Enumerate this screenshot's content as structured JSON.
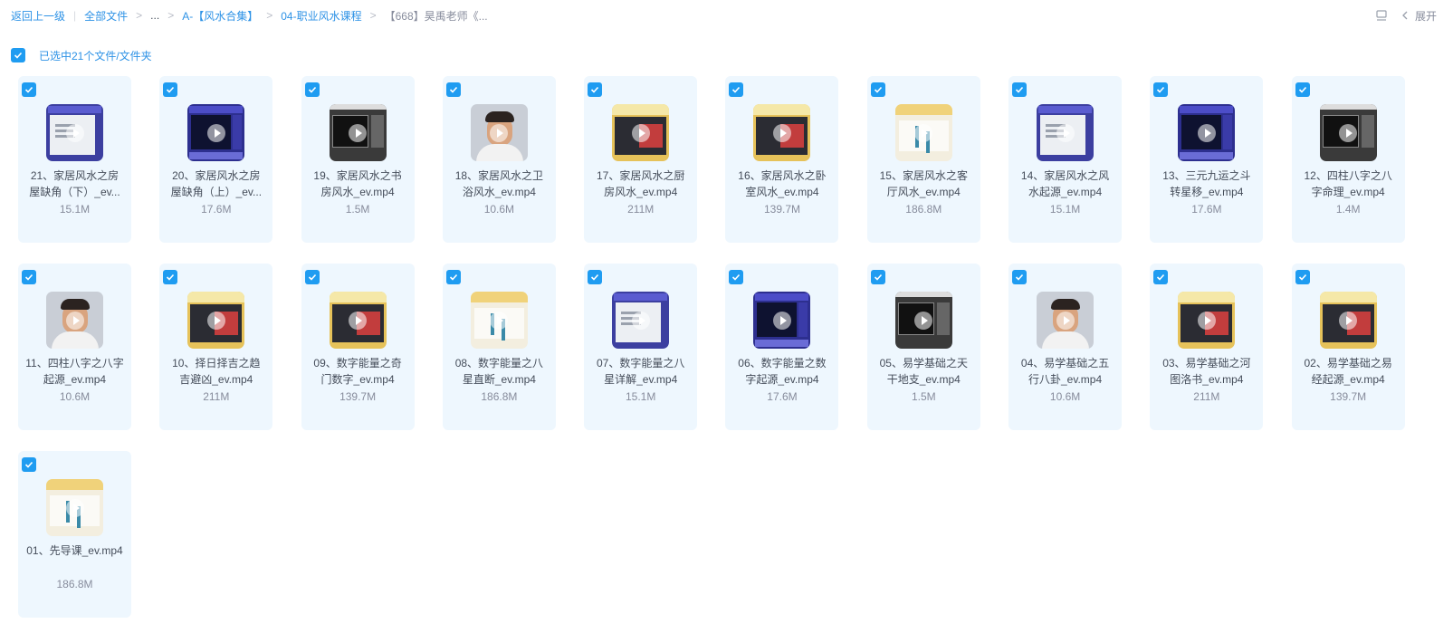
{
  "breadcrumb": {
    "back": "返回上一级",
    "items": [
      "全部文件",
      "...",
      "A-【风水合集】",
      "04-职业风水课程"
    ],
    "current": "【668】昊禹老师《..."
  },
  "toolbar": {
    "expand_label": "展开"
  },
  "selection": {
    "label": "已选中21个文件/文件夹",
    "checked": true
  },
  "files": [
    {
      "name": "21、家居风水之房屋缺角（下）_ev...",
      "size": "15.1M",
      "thumb": "doc"
    },
    {
      "name": "20、家居风水之房屋缺角（上）_ev...",
      "size": "17.6M",
      "thumb": "blue"
    },
    {
      "name": "19、家居风水之书房风水_ev.mp4",
      "size": "1.5M",
      "thumb": "dark"
    },
    {
      "name": "18、家居风水之卫浴风水_ev.mp4",
      "size": "10.6M",
      "thumb": "face"
    },
    {
      "name": "17、家居风水之厨房风水_ev.mp4",
      "size": "211M",
      "thumb": "gold"
    },
    {
      "name": "16、家居风水之卧室风水_ev.mp4",
      "size": "139.7M",
      "thumb": "gold"
    },
    {
      "name": "15、家居风水之客厅风水_ev.mp4",
      "size": "186.8M",
      "thumb": "white"
    },
    {
      "name": "14、家居风水之风水起源_ev.mp4",
      "size": "15.1M",
      "thumb": "doc"
    },
    {
      "name": "13、三元九运之斗转星移_ev.mp4",
      "size": "17.6M",
      "thumb": "blue"
    },
    {
      "name": "12、四柱八字之八字命理_ev.mp4",
      "size": "1.4M",
      "thumb": "dark"
    },
    {
      "name": "11、四柱八字之八字起源_ev.mp4",
      "size": "10.6M",
      "thumb": "face"
    },
    {
      "name": "10、择日择吉之趋吉避凶_ev.mp4",
      "size": "211M",
      "thumb": "gold"
    },
    {
      "name": "09、数字能量之奇门数字_ev.mp4",
      "size": "139.7M",
      "thumb": "gold"
    },
    {
      "name": "08、数字能量之八星直断_ev.mp4",
      "size": "186.8M",
      "thumb": "white"
    },
    {
      "name": "07、数字能量之八星详解_ev.mp4",
      "size": "15.1M",
      "thumb": "doc"
    },
    {
      "name": "06、数字能量之数字起源_ev.mp4",
      "size": "17.6M",
      "thumb": "blue"
    },
    {
      "name": "05、易学基础之天干地支_ev.mp4",
      "size": "1.5M",
      "thumb": "dark"
    },
    {
      "name": "04、易学基础之五行八卦_ev.mp4",
      "size": "10.6M",
      "thumb": "face"
    },
    {
      "name": "03、易学基础之河图洛书_ev.mp4",
      "size": "211M",
      "thumb": "gold"
    },
    {
      "name": "02、易学基础之易经起源_ev.mp4",
      "size": "139.7M",
      "thumb": "gold"
    },
    {
      "name": "01、先导课_ev.mp4",
      "size": "186.8M",
      "thumb": "white"
    }
  ],
  "colors": {
    "accent": "#2d92e6",
    "checkbox": "#1f9cf1",
    "card_bg": "#eef7fe",
    "text": "#454d5a",
    "muted": "#878c9c"
  },
  "icons": {
    "checkbox": "check-icon",
    "view_mode": "list-view-icon",
    "collapse": "chevron-left-icon",
    "play": "play-icon"
  }
}
